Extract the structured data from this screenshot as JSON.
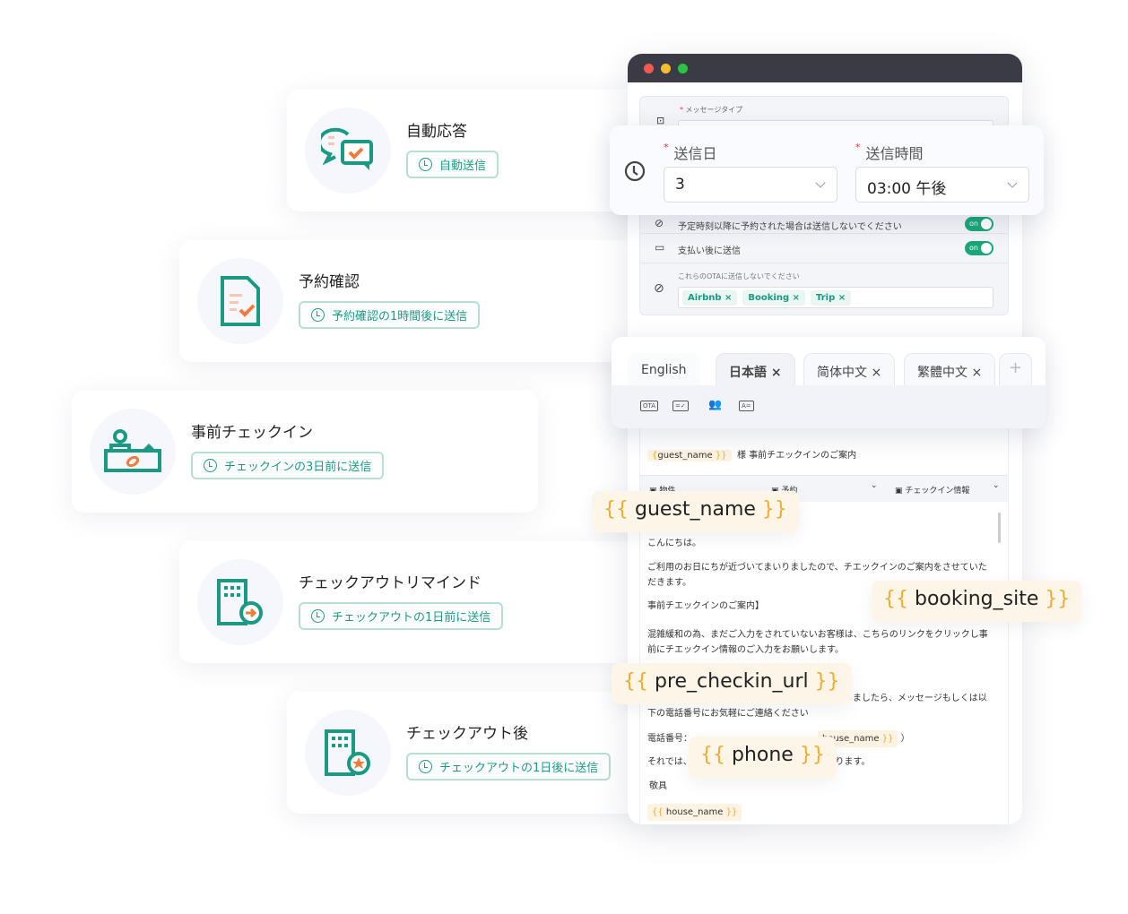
{
  "cards": [
    {
      "title": "自動応答",
      "badge": "自動送信",
      "icon": "chat-check-icon"
    },
    {
      "title": "予約確認",
      "badge": "予約確認の1時間後に送信",
      "icon": "document-check-icon"
    },
    {
      "title": "事前チェックイン",
      "badge": "チェックインの3日前に送信",
      "icon": "reception-desk-icon"
    },
    {
      "title": "チェックアウトリマインド",
      "badge": "チェックアウトの1日前に送信",
      "icon": "building-arrow-icon"
    },
    {
      "title": "チェックアウト後",
      "badge": "チェックアウトの1日後に送信",
      "icon": "building-star-icon"
    }
  ],
  "colors": {
    "accent": "#1a9a84",
    "orange": "#f07b3f",
    "toggle": "#19a777",
    "variable_brace": "#f0ac2f",
    "titlebar": "#3a3b45"
  },
  "form": {
    "message_type_label": "メッセージタイプ",
    "no_send_after_label": "予定時刻以降に予約された場合は送信しないでください",
    "no_send_after_toggle": "on",
    "send_after_payment_label": "支払い後に送信",
    "send_after_payment_toggle": "on",
    "exclude_ota_label": "これらのOTAに送信しないでください",
    "ota_tags": [
      "Airbnb ×",
      "Booking ×",
      "Trip ×"
    ]
  },
  "schedule": {
    "day_label": "送信日",
    "day_value": "3",
    "time_label": "送信時間",
    "time_value": "03:00 午後"
  },
  "tabs": [
    {
      "label": "English"
    },
    {
      "label": "日本語 ×"
    },
    {
      "label": "简体中文 ×"
    },
    {
      "label": "繁體中文 ×"
    }
  ],
  "tab_add": "+",
  "toolbar_icons": [
    "OTA",
    "=✓",
    "👥",
    "A="
  ],
  "editor": {
    "subject_var": "guest_name",
    "subject_text": "様  事前チエックインのご案内",
    "dropdowns": [
      "物件",
      "予約",
      "チェックイン情報"
    ],
    "lines": [
      "こんにちは。",
      "ご利用のお日にちが近づいてまいりましたので、チエックインのご案内をさせていただきます。",
      "事前チエックインのご案内】",
      "混雑緩和の為、まだご入力をされていないお客様は、こちらのリンクをクリックし事前にチエックイン情報のご入力をお願いします。",
      "ご宿泊中の件につきましても、何かご質問がございましたら、メッセージもしくは以下の電話番号にお気軽にご連絡ください"
    ],
    "phone_label": "電話番号：",
    "house_var": "house_name",
    "closing_prefix": "それでは、",
    "closing_suffix": "ております。",
    "regards": "敬具",
    "signature_var": "house_name"
  },
  "chips": [
    "guest_name",
    "booking_site",
    "pre_checkin_url",
    "phone"
  ]
}
